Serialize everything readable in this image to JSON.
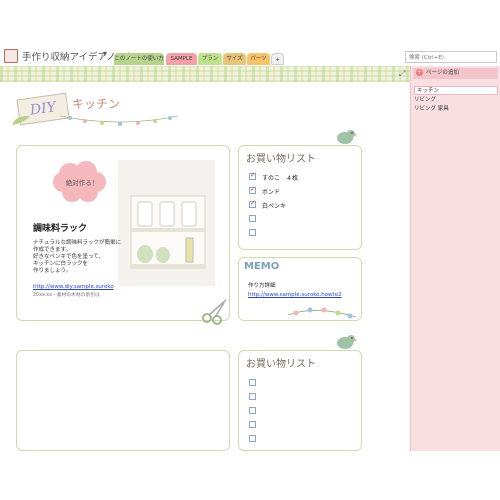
{
  "notebook": {
    "title": "手作り収納アイデアノート",
    "dropdown": "▾",
    "tabs": [
      {
        "label": "このノートの使い方",
        "color": "#b6d48c"
      },
      {
        "label": "SAMPLE",
        "color": "#f3a0a6"
      },
      {
        "label": "プラン",
        "color": "#bfe08c"
      },
      {
        "label": "サイズ",
        "color": "#e8c37a"
      },
      {
        "label": "パーツ",
        "color": "#f5c36a"
      },
      {
        "label": "+",
        "color": "#f0f0f0"
      }
    ],
    "search_placeholder": "検索 (Ctrl+E)"
  },
  "pane": {
    "add_page": "ページの追加",
    "pages": [
      "キッチン",
      "リビング",
      "リビング 家具"
    ]
  },
  "header": {
    "diy": "DIY",
    "section_title": "キッチン"
  },
  "main_card": {
    "badge": "絶対作る！",
    "item_title": "調味料ラック",
    "description": [
      "ナチュラルな調味料ラックが簡単に",
      "作成できます。",
      "好きなペンキで色を塗って、",
      "キッチンに白ラックを",
      "作りましょう。"
    ],
    "link": "http://www.diy.sample.suroko",
    "date": "20xx.xx - 素材の木材の割引は"
  },
  "shopping1": {
    "title": "お買い物リスト",
    "items": [
      {
        "label": "すのこ　４枚",
        "checked": true
      },
      {
        "label": "ボンド",
        "checked": true
      },
      {
        "label": "白ペンキ",
        "checked": true
      },
      {
        "label": "",
        "checked": false
      },
      {
        "label": "",
        "checked": false
      }
    ]
  },
  "memo": {
    "title": "MEMO",
    "subtitle": "作り方詳細",
    "link": "http://www.sample.suroko.howto2"
  },
  "shopping2": {
    "title": "お買い物リスト"
  },
  "colors": {
    "pane_bg": "#f9dfe2",
    "card_border": "#cddbb1",
    "accent_pink": "#f3a0a6",
    "link": "#2a45c8"
  }
}
